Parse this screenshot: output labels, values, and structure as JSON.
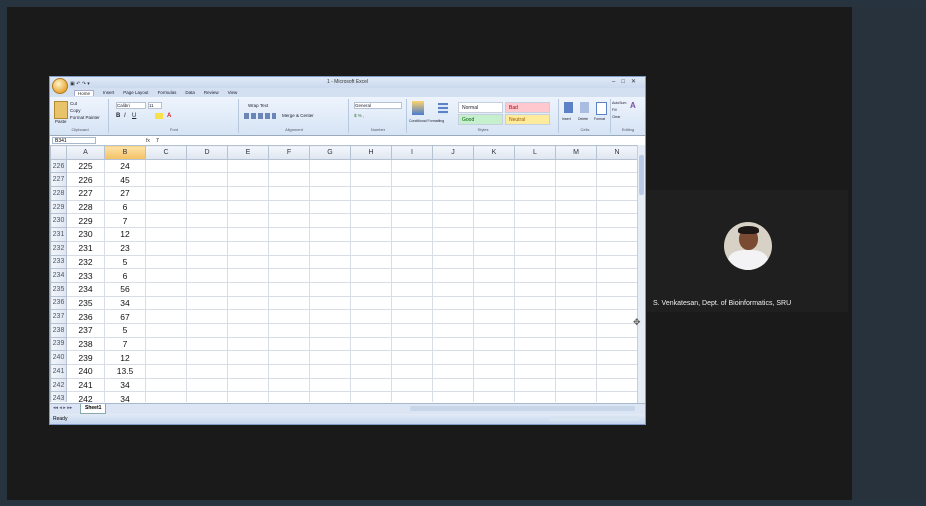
{
  "excel": {
    "title": "1 - Microsoft Excel",
    "quick_access": "▣ ↶ ↷ ▾",
    "window_controls": [
      "–",
      "□",
      "✕"
    ],
    "tabs": [
      "Home",
      "Insert",
      "Page Layout",
      "Formulas",
      "Data",
      "Review",
      "View"
    ],
    "ribbon": {
      "font_name": "Calibri",
      "font_size": "11",
      "number_format": "General",
      "styles": {
        "normal": "Normal",
        "bad": "Bad",
        "good": "Good",
        "neutral": "Neutral"
      },
      "group_labels": [
        "Clipboard",
        "Font",
        "Alignment",
        "Number",
        "Styles",
        "Cells",
        "Editing"
      ],
      "buttons": {
        "paste": "Paste",
        "cut": "Cut",
        "copy": "Copy",
        "format_painter": "Format Painter",
        "wrap_text": "Wrap Text",
        "merge_center": "Merge & Center",
        "conditional": "Conditional Formatting",
        "format_table": "Format as Table",
        "insert": "Insert",
        "delete": "Delete",
        "format": "Format",
        "autosum": "AutoSum",
        "fill": "Fill",
        "clear": "Clear",
        "sort_filter": "Sort & Filter",
        "find_select": "Find & Select"
      }
    },
    "formula_bar": {
      "name_box": "B341",
      "fx": "fx",
      "value": "7"
    },
    "columns": [
      "A",
      "B",
      "C",
      "D",
      "E",
      "F",
      "G",
      "H",
      "I",
      "J",
      "K",
      "L",
      "M",
      "N"
    ],
    "rows": [
      {
        "num": "226",
        "a": "225",
        "b": "24"
      },
      {
        "num": "227",
        "a": "226",
        "b": "45"
      },
      {
        "num": "228",
        "a": "227",
        "b": "27"
      },
      {
        "num": "229",
        "a": "228",
        "b": "6"
      },
      {
        "num": "230",
        "a": "229",
        "b": "7"
      },
      {
        "num": "231",
        "a": "230",
        "b": "12"
      },
      {
        "num": "232",
        "a": "231",
        "b": "23"
      },
      {
        "num": "233",
        "a": "232",
        "b": "5"
      },
      {
        "num": "234",
        "a": "233",
        "b": "6"
      },
      {
        "num": "235",
        "a": "234",
        "b": "56"
      },
      {
        "num": "236",
        "a": "235",
        "b": "34"
      },
      {
        "num": "237",
        "a": "236",
        "b": "67"
      },
      {
        "num": "238",
        "a": "237",
        "b": "5"
      },
      {
        "num": "239",
        "a": "238",
        "b": "7"
      },
      {
        "num": "240",
        "a": "239",
        "b": "12"
      },
      {
        "num": "241",
        "a": "240",
        "b": "13.5"
      },
      {
        "num": "242",
        "a": "241",
        "b": "34"
      },
      {
        "num": "243",
        "a": "242",
        "b": "34"
      }
    ],
    "sheet_tab": "Sheet1",
    "status": "Ready"
  },
  "video": {
    "participant_name": "S. Venkatesan, Dept. of Bioinformatics, SRU"
  }
}
